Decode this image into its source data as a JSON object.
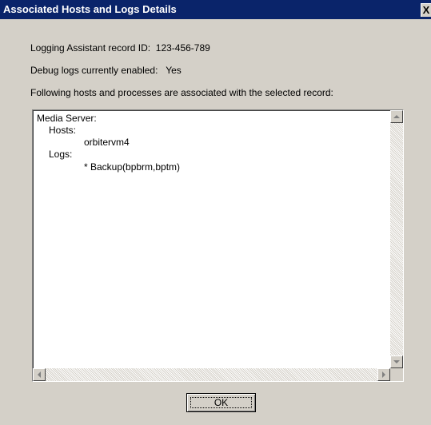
{
  "window": {
    "title": "Associated Hosts and Logs Details",
    "close_symbol": "X"
  },
  "info": {
    "record_id_label": "Logging Assistant record ID:",
    "record_id_value": "123-456-789",
    "debug_label": "Debug logs currently enabled:",
    "debug_value": "Yes",
    "description": "Following hosts and processes are associated with the selected record:"
  },
  "details": {
    "server_type": "Media Server:",
    "hosts_label": "Hosts:",
    "host_name": "orbitervm4",
    "logs_label": "Logs:",
    "log_entry": "* Backup(bpbrm,bptm)"
  },
  "buttons": {
    "ok_label": "OK"
  },
  "colors": {
    "titlebar": "#0a246a",
    "dialog_face": "#d4d0c8",
    "textbox_bg": "#ffffff"
  }
}
